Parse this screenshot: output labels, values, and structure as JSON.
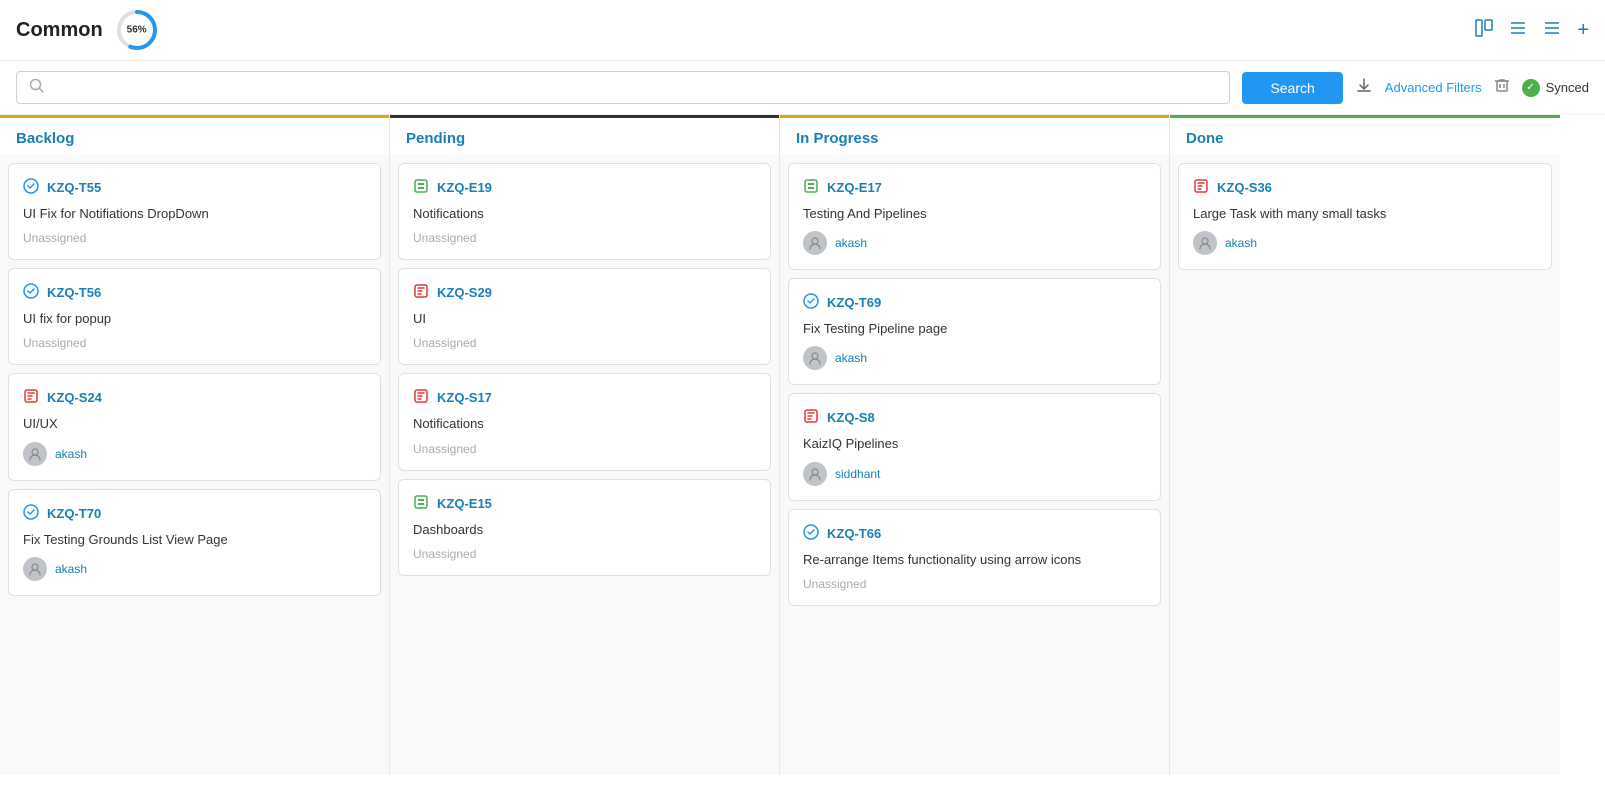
{
  "header": {
    "title": "Common",
    "progress": 56,
    "icons": {
      "kanban": "⊞",
      "list": "☰",
      "menu": "≡",
      "add": "+"
    }
  },
  "search": {
    "placeholder": "",
    "button_label": "Search",
    "advanced_filters_label": "Advanced Filters",
    "sync_label": "Synced"
  },
  "columns": [
    {
      "id": "backlog",
      "title": "Backlog",
      "cards": [
        {
          "id": "KZQ-T55",
          "icon": "task",
          "title": "UI Fix for Notifiations DropDown",
          "assignee": "Unassigned"
        },
        {
          "id": "KZQ-T56",
          "icon": "task",
          "title": "UI fix for popup",
          "assignee": "Unassigned"
        },
        {
          "id": "KZQ-S24",
          "icon": "story",
          "title": "UI/UX",
          "assignee": "akash"
        },
        {
          "id": "KZQ-T70",
          "icon": "task",
          "title": "Fix Testing Grounds List View Page",
          "assignee": "akash"
        }
      ]
    },
    {
      "id": "pending",
      "title": "Pending",
      "cards": [
        {
          "id": "KZQ-E19",
          "icon": "epic",
          "title": "Notifications",
          "assignee": "Unassigned"
        },
        {
          "id": "KZQ-S29",
          "icon": "story",
          "title": "UI",
          "assignee": "Unassigned"
        },
        {
          "id": "KZQ-S17",
          "icon": "story",
          "title": "Notifications",
          "assignee": "Unassigned"
        },
        {
          "id": "KZQ-E15",
          "icon": "epic",
          "title": "Dashboards",
          "assignee": "Unassigned"
        }
      ]
    },
    {
      "id": "in-progress",
      "title": "In Progress",
      "cards": [
        {
          "id": "KZQ-E17",
          "icon": "epic",
          "title": "Testing And Pipelines",
          "assignee": "akash"
        },
        {
          "id": "KZQ-T69",
          "icon": "task",
          "title": "Fix Testing Pipeline page",
          "assignee": "akash"
        },
        {
          "id": "KZQ-S8",
          "icon": "story",
          "title": "KaizIQ Pipelines",
          "assignee": "siddhant"
        },
        {
          "id": "KZQ-T66",
          "icon": "task",
          "title": "Re-arrange Items functionality using arrow icons",
          "assignee": "Unassigned"
        }
      ]
    },
    {
      "id": "done",
      "title": "Done",
      "cards": [
        {
          "id": "KZQ-S36",
          "icon": "story",
          "title": "Large Task with many small tasks",
          "assignee": "akash"
        }
      ]
    }
  ]
}
